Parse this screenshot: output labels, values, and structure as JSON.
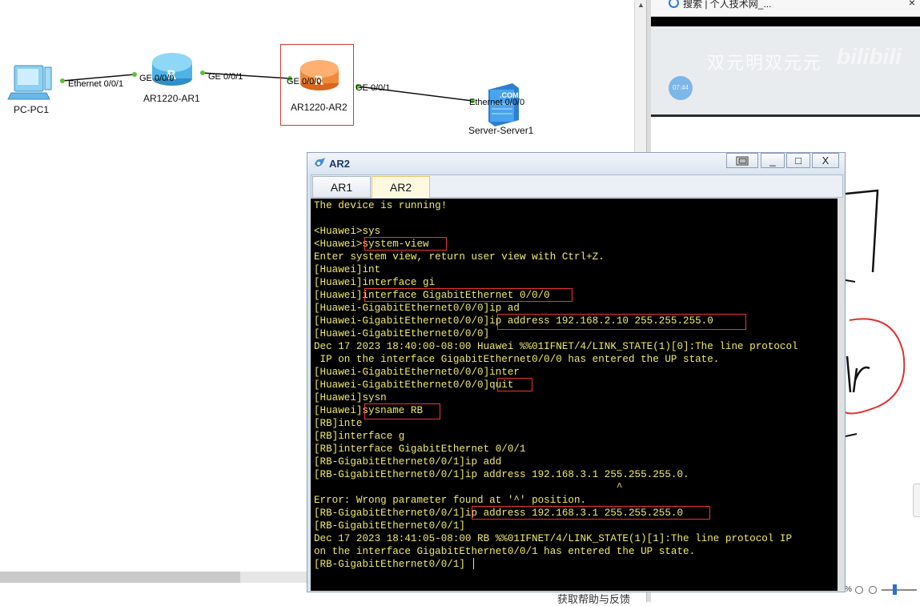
{
  "topology": {
    "nodes": [
      {
        "name": "PC-PC1"
      },
      {
        "name": "AR1220-AR1"
      },
      {
        "name": "AR1220-AR2"
      },
      {
        "name": "Server-Server1"
      }
    ],
    "ports": {
      "pc1_eth": "Ethernet 0/0/1",
      "ar1_ge000": "GE 0/0/0",
      "ar1_ge001": "GE 0/0/1",
      "ar2_ge000": "GE 0/0/0",
      "ar2_ge001": "GE 0/0/1",
      "server_eth": "Ethernet 0/0/0"
    },
    "server_badge": ".COM"
  },
  "browser": {
    "tab_title": "搜索 | 个人技术网_...",
    "close": "×",
    "watermark": "双元明双元元",
    "logo": "bilibili",
    "video_time": "07:44"
  },
  "footer": {
    "text": "获取帮助与反馈",
    "zoom": "%"
  },
  "terminal": {
    "title": "AR2",
    "tabs": [
      {
        "label": "AR1",
        "active": false
      },
      {
        "label": "AR2",
        "active": true
      }
    ],
    "buttons": {
      "minimize": "_",
      "maximize": "□",
      "close": "X"
    },
    "lines": [
      "The device is running!",
      "",
      "<Huawei>sys",
      "<Huawei>system-view",
      "Enter system view, return user view with Ctrl+Z.",
      "[Huawei]int",
      "[Huawei]interface gi",
      "[Huawei]interface GigabitEthernet 0/0/0",
      "[Huawei-GigabitEthernet0/0/0]ip ad",
      "[Huawei-GigabitEthernet0/0/0]ip address 192.168.2.10 255.255.255.0",
      "[Huawei-GigabitEthernet0/0/0]",
      "Dec 17 2023 18:40:00-08:00 Huawei %%01IFNET/4/LINK_STATE(1)[0]:The line protocol",
      " IP on the interface GigabitEthernet0/0/0 has entered the UP state.",
      "[Huawei-GigabitEthernet0/0/0]inter",
      "[Huawei-GigabitEthernet0/0/0]quit",
      "[Huawei]sysn",
      "[Huawei]sysname RB",
      "[RB]inte",
      "[RB]interface g",
      "[RB]interface GigabitEthernet 0/0/1",
      "[RB-GigabitEthernet0/0/1]ip add",
      "[RB-GigabitEthernet0/0/1]ip address 192.168.3.1 255.255.255.0.",
      "                                                  ^",
      "Error: Wrong parameter found at '^' position.",
      "[RB-GigabitEthernet0/0/1]ip address 192.168.3.1 255.255.255.0",
      "[RB-GigabitEthernet0/0/1]",
      "Dec 17 2023 18:41:05-08:00 RB %%01IFNET/4/LINK_STATE(1)[1]:The line protocol IP",
      "on the interface GigabitEthernet0/0/1 has entered the UP state.",
      "[RB-GigabitEthernet0/0/1]"
    ]
  },
  "colors": {
    "console_text": "#f0ea6a",
    "highlight_border": "#e33333",
    "router_blue": "#4fb3e6",
    "router_orange": "#f08a3a"
  }
}
